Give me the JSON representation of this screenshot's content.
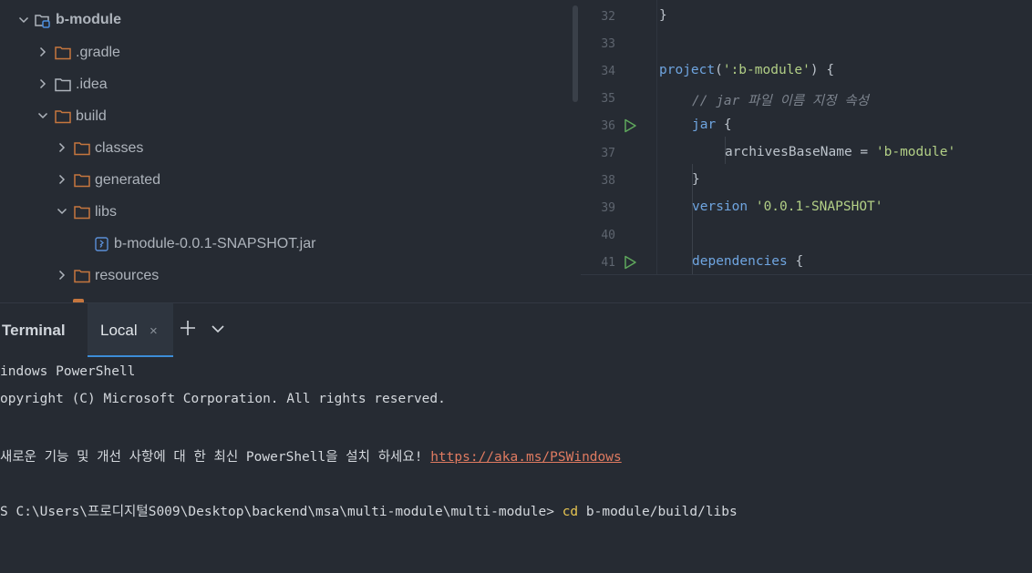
{
  "tree": {
    "items": [
      {
        "label": "b-module",
        "icon": "module-folder-icon",
        "expanded": true
      },
      {
        "label": ".gradle",
        "icon": "folder-icon",
        "expanded": false
      },
      {
        "label": ".idea",
        "icon": "folder-icon",
        "expanded": false
      },
      {
        "label": "build",
        "icon": "folder-icon",
        "expanded": true
      },
      {
        "label": "classes",
        "icon": "folder-icon",
        "expanded": false
      },
      {
        "label": "generated",
        "icon": "folder-icon",
        "expanded": false
      },
      {
        "label": "libs",
        "icon": "folder-icon",
        "expanded": true
      },
      {
        "label": "b-module-0.0.1-SNAPSHOT.jar",
        "icon": "jar-file-icon"
      },
      {
        "label": "resources",
        "icon": "folder-icon",
        "expanded": false
      }
    ]
  },
  "editor": {
    "lines": [
      {
        "num": "32",
        "text": "}"
      },
      {
        "num": "33",
        "text": ""
      },
      {
        "num": "34",
        "text": "project(':b-module') {"
      },
      {
        "num": "35",
        "text": "// jar 파일 이름 지정 속성"
      },
      {
        "num": "36",
        "text": "jar {"
      },
      {
        "num": "37",
        "text": "archivesBaseName = 'b-module'"
      },
      {
        "num": "38",
        "text": "}"
      },
      {
        "num": "39",
        "text": "version '0.0.1-SNAPSHOT'"
      },
      {
        "num": "40",
        "text": ""
      },
      {
        "num": "41",
        "text": "dependencies {"
      }
    ],
    "tokens": {
      "l32_brace": "}",
      "l34_fn": "project",
      "l34_open": "(",
      "l34_str": "':b-module'",
      "l34_close": ") {",
      "l35_comment": "// jar 파일 이름 지정 속성",
      "l36_kw": "jar",
      "l36_brace": " {",
      "l37_prop": "archivesBaseName = ",
      "l37_str": "'b-module'",
      "l38_brace": "}",
      "l39_kw": "version",
      "l39_str": "'0.0.1-SNAPSHOT'",
      "l41_kw": "dependencies",
      "l41_brace": " {"
    }
  },
  "terminal": {
    "title": "Terminal",
    "tab_label": "Local",
    "tab_close": "×",
    "lines": {
      "l1": "indows PowerShell",
      "l2": "opyright (C) Microsoft Corporation. All rights reserved.",
      "l3_text": "새로운 기능 및 개선 사항에 대 한 최신 PowerShell을 설치 하세요! ",
      "l3_link": "https://aka.ms/PSWindows",
      "l4_prompt": "S C:\\Users\\프로디지털S009\\Desktop\\backend\\msa\\multi-module\\multi-module> ",
      "l4_cmd": "cd",
      "l4_args": " b-module/build/libs"
    }
  },
  "colors": {
    "background": "#262B33",
    "folder": "#C5763E",
    "keyword": "#6FA5E0",
    "string": "#B2CF86",
    "link": "#E07B61",
    "command": "#E5C451",
    "run_icon": "#5FA85C",
    "tab_accent": "#3C8DD8"
  }
}
